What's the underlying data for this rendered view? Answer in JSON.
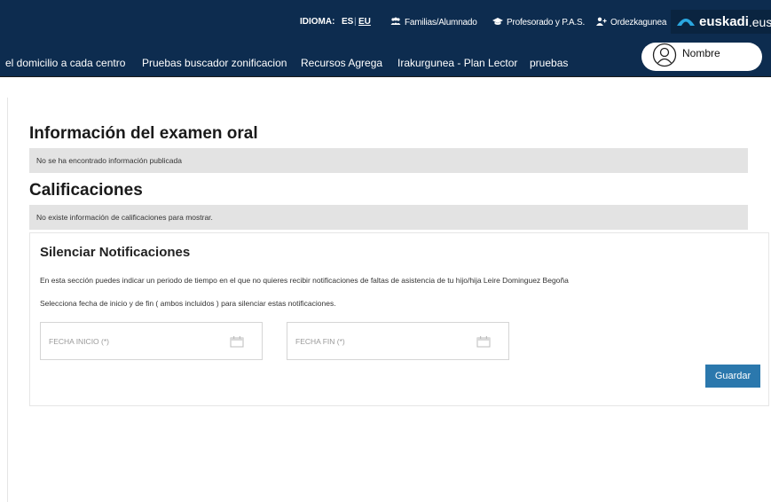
{
  "topbar": {
    "idioma_label": "IDIOMA:",
    "lang_es": "ES",
    "lang_separator": "|",
    "lang_eu": "EU",
    "links": [
      {
        "icon": "users-icon",
        "label": "Familias/Alumnado"
      },
      {
        "icon": "graduation-cap-icon",
        "label": "Profesorado y P.A.S."
      },
      {
        "icon": "user-plus-icon",
        "label": "Ordezkagunea"
      }
    ],
    "brand": {
      "name": "euskadi",
      "ext": ".eus",
      "logo_icon": "euskadi-arc-logo-icon"
    }
  },
  "nav": {
    "items": [
      "el domicilio a cada centro",
      "Pruebas buscador zonificacion",
      "Recursos Agrega",
      "Irakurgunea - Plan Lector",
      "pruebas"
    ],
    "user_icon": "user-face-icon",
    "user_name": "Nombre"
  },
  "sections": {
    "oral_title": "Información del examen oral",
    "oral_msg": "No se ha encontrado información publicada",
    "grades_title": "Calificaciones",
    "grades_msg": "No existe información de calificaciones para mostrar."
  },
  "silence": {
    "title": "Silenciar Notificaciones",
    "desc": "En esta sección puedes indicar un periodo de tiempo en el que no quieres recibir notificaciones de faltas de asistencia de tu hijo/hija Leire Dominguez Begoña",
    "instruction": "Selecciona fecha de inicio y de fin ( ambos incluidos ) para silenciar estas notificaciones.",
    "start_placeholder": "FECHA INICIO (*)",
    "end_placeholder": "FECHA FIN (*)",
    "calendar_icon": "calendar-icon",
    "save_label": "Guardar"
  },
  "colors": {
    "header_bg": "#0d2c4f",
    "button_bg": "#2b78ad",
    "info_bar_bg": "#e3e3e3"
  }
}
